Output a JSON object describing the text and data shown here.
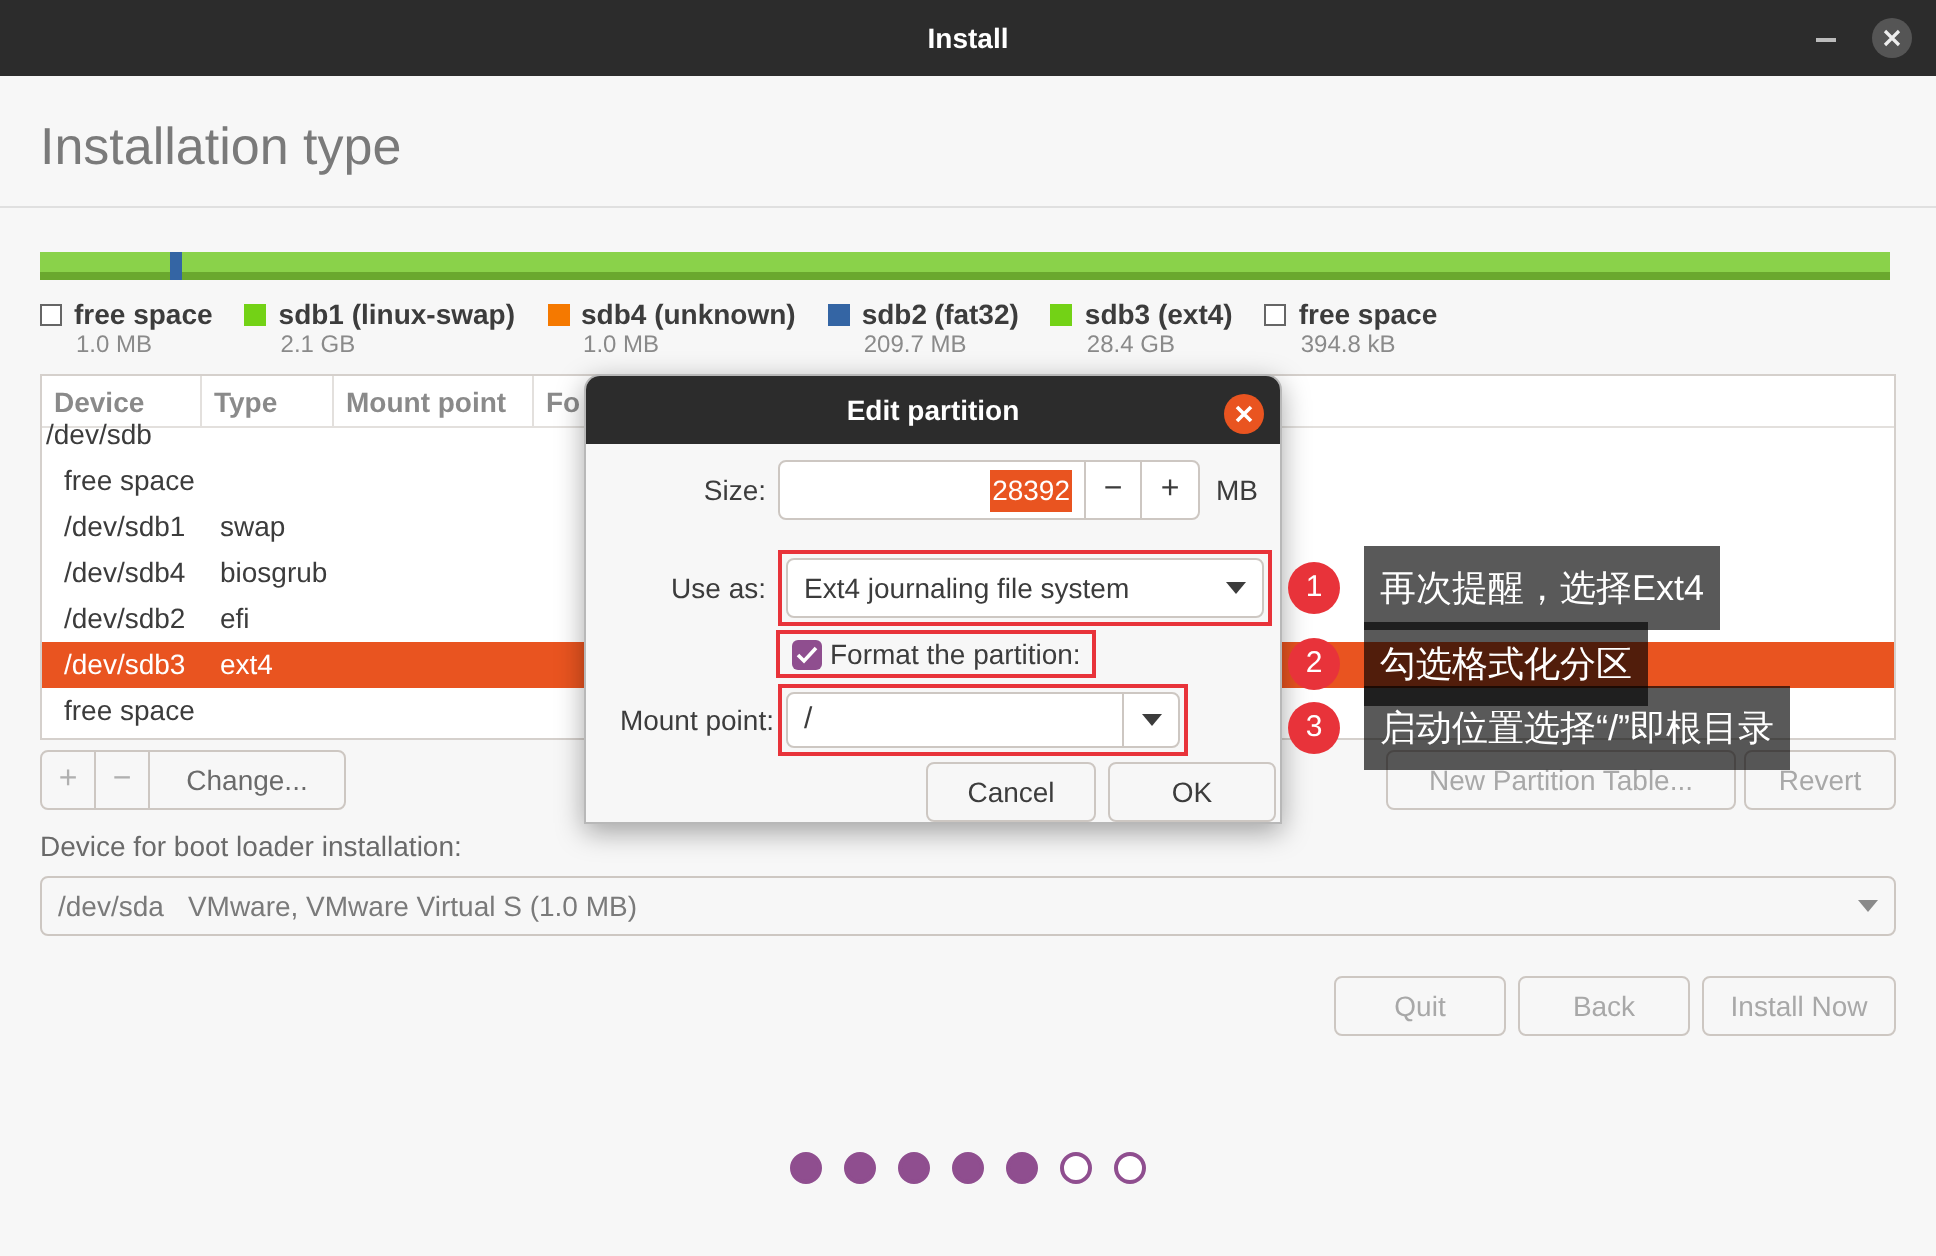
{
  "window": {
    "title": "Install"
  },
  "heading": "Installation type",
  "legend": [
    {
      "kind": "free",
      "label": "free space",
      "size": "1.0 MB"
    },
    {
      "kind": "partition",
      "label": "sdb1 (linux-swap)",
      "size": "2.1 GB",
      "color": "#73d216"
    },
    {
      "kind": "partition",
      "label": "sdb4 (unknown)",
      "size": "1.0 MB",
      "color": "#f57900"
    },
    {
      "kind": "partition",
      "label": "sdb2 (fat32)",
      "size": "209.7 MB",
      "color": "#3465a4"
    },
    {
      "kind": "partition",
      "label": "sdb3 (ext4)",
      "size": "28.4 GB",
      "color": "#73d216"
    },
    {
      "kind": "free",
      "label": "free space",
      "size": "394.8 kB"
    }
  ],
  "table": {
    "columns": [
      "Device",
      "Type",
      "Mount point",
      "Fo"
    ],
    "rows": [
      {
        "kind": "disk",
        "device": "/dev/sdb",
        "selected": false
      },
      {
        "kind": "partition",
        "device": "free space",
        "selected": false
      },
      {
        "kind": "partition",
        "device": "/dev/sdb1",
        "type": "swap",
        "selected": false
      },
      {
        "kind": "partition",
        "device": "/dev/sdb4",
        "type": "biosgrub",
        "selected": false
      },
      {
        "kind": "partition",
        "device": "/dev/sdb2",
        "type": "efi",
        "selected": false
      },
      {
        "kind": "partition",
        "device": "/dev/sdb3",
        "type": "ext4",
        "selected": true
      },
      {
        "kind": "partition",
        "device": "free space",
        "selected": false
      }
    ]
  },
  "toolbar": {
    "add": {
      "label": "+",
      "disabled": true
    },
    "remove": {
      "label": "−",
      "disabled": true
    },
    "change": {
      "label": "Change...",
      "disabled": false
    },
    "new_table": {
      "label": "New Partition Table...",
      "disabled": true
    },
    "revert": {
      "label": "Revert",
      "disabled": true
    }
  },
  "boot_loader": {
    "label": "Device for boot loader installation:",
    "device": "/dev/sda",
    "description": "VMware, VMware Virtual S (1.0 MB)"
  },
  "nav_buttons": [
    {
      "label": "Quit",
      "disabled": true
    },
    {
      "label": "Back",
      "disabled": true
    },
    {
      "label": "Install Now",
      "disabled": true
    }
  ],
  "steps": [
    {
      "done": true
    },
    {
      "done": true
    },
    {
      "done": true
    },
    {
      "done": true
    },
    {
      "done": true
    },
    {
      "done": false
    },
    {
      "done": false
    }
  ],
  "dialog": {
    "title": "Edit partition",
    "size_label": "Size:",
    "size_value": "28392",
    "decrement": "−",
    "increment": "+",
    "size_unit": "MB",
    "use_as_label": "Use as:",
    "use_as_value": "Ext4 journaling file system",
    "format_label": "Format the partition:",
    "format_checked": true,
    "mount_label": "Mount point:",
    "mount_value": "/",
    "buttons": [
      "Cancel",
      "OK"
    ]
  },
  "annotations": [
    {
      "number": "1",
      "text": "再次提醒，选择Ext4"
    },
    {
      "number": "2",
      "text": "勾选格式化分区"
    },
    {
      "number": "3",
      "text": "启动位置选择“/”即根目录"
    }
  ]
}
